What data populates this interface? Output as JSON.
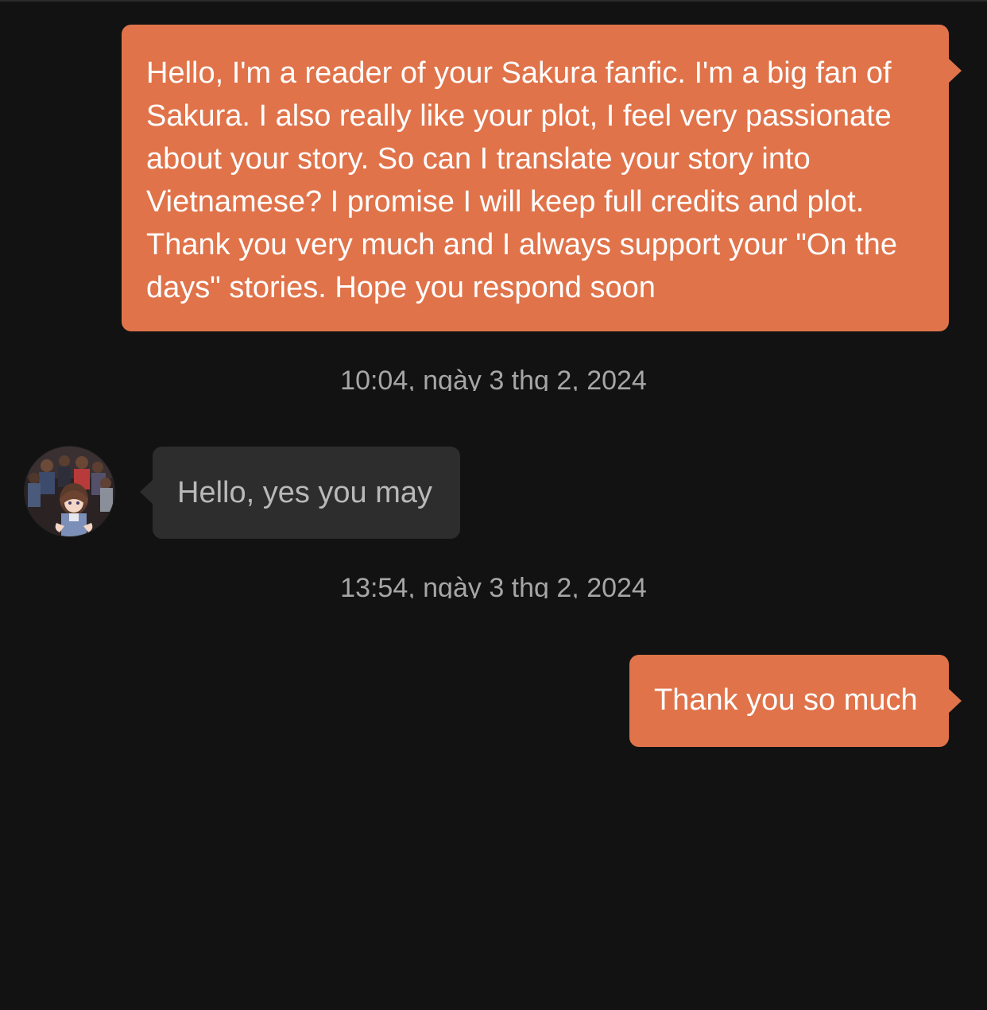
{
  "messages": [
    {
      "side": "outgoing",
      "text": "Hello, I'm a reader of your Sakura fanfic. I'm a big fan of Sakura. I also really like your plot, I feel very passionate about your story. So can I translate your story into Vietnamese? I promise I will keep full credits and plot. Thank you very much and I always support your \"On the days\" stories. Hope you respond soon"
    },
    {
      "side": "incoming",
      "text": "Hello, yes you may"
    },
    {
      "side": "outgoing",
      "text": "Thank you so much"
    }
  ],
  "timestamps": [
    "10:04, ngày 3 thg 2, 2024",
    "13:54, ngày 3 thg 2, 2024"
  ],
  "colors": {
    "background": "#121212",
    "outgoing_bubble": "#e0734a",
    "incoming_bubble": "#2d2d2d",
    "incoming_text": "#b9b9b9",
    "timestamp_text": "#a6a6a6"
  }
}
